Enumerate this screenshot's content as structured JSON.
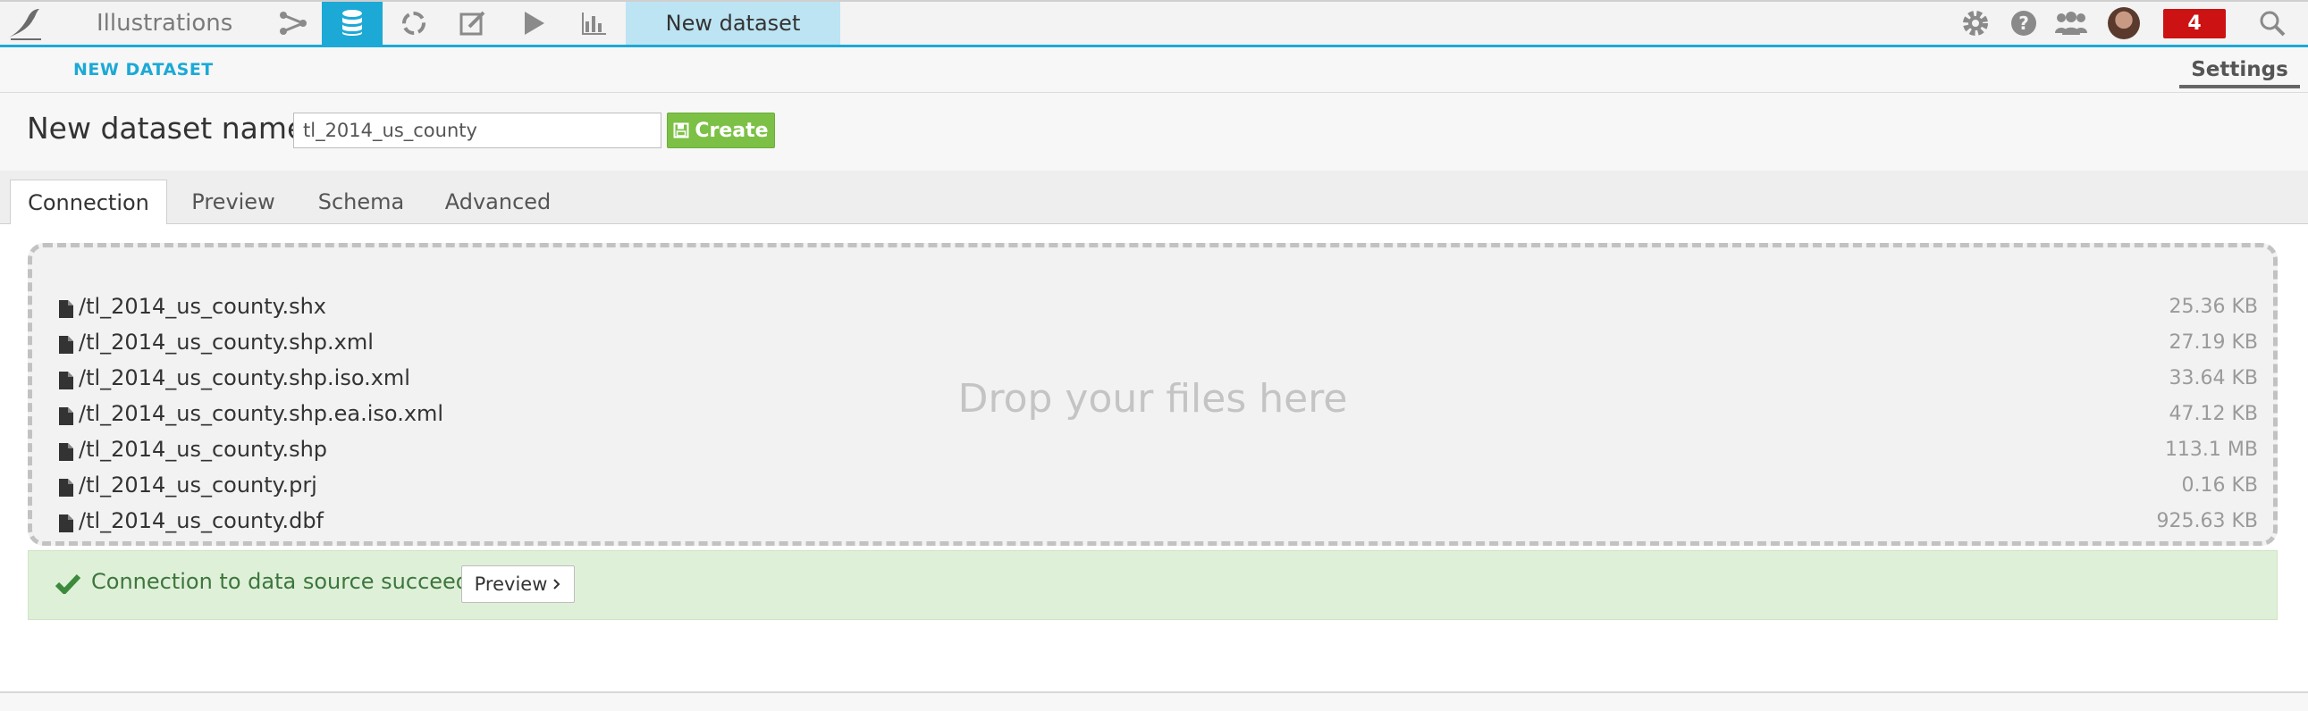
{
  "topnav": {
    "project_name": "Illustrations",
    "dataset_tab": "New dataset",
    "notification_count": "4",
    "icons": [
      "bird-logo-icon",
      "flow-icon",
      "datasets-icon",
      "recipes-icon",
      "notebooks-icon",
      "jobs-icon",
      "dashboards-icon",
      "gear-icon",
      "help-icon",
      "users-icon",
      "avatar",
      "search-icon"
    ],
    "accent_color": "#1ca9d6",
    "alert_color": "#cc1212"
  },
  "subheader": {
    "breadcrumb": "NEW DATASET",
    "settings_tab": "Settings"
  },
  "form": {
    "name_label": "New dataset name",
    "name_value": "tl_2014_us_county",
    "create_label": "Create",
    "create_color": "#7cc046"
  },
  "tabs": [
    {
      "label": "Connection",
      "active": true
    },
    {
      "label": "Preview",
      "active": false
    },
    {
      "label": "Schema",
      "active": false
    },
    {
      "label": "Advanced",
      "active": false
    }
  ],
  "dropzone": {
    "placeholder": "Drop your files here",
    "files": [
      {
        "name": "/tl_2014_us_county.shx",
        "size": "25.36 KB"
      },
      {
        "name": "/tl_2014_us_county.shp.xml",
        "size": "27.19 KB"
      },
      {
        "name": "/tl_2014_us_county.shp.iso.xml",
        "size": "33.64 KB"
      },
      {
        "name": "/tl_2014_us_county.shp.ea.iso.xml",
        "size": "47.12 KB"
      },
      {
        "name": "/tl_2014_us_county.shp",
        "size": "113.1 MB"
      },
      {
        "name": "/tl_2014_us_county.prj",
        "size": "0.16 KB"
      },
      {
        "name": "/tl_2014_us_county.dbf",
        "size": "925.63 KB"
      }
    ]
  },
  "status": {
    "message": "Connection to data source succeeded",
    "preview_label": "Preview",
    "success_color": "#3c763d"
  }
}
